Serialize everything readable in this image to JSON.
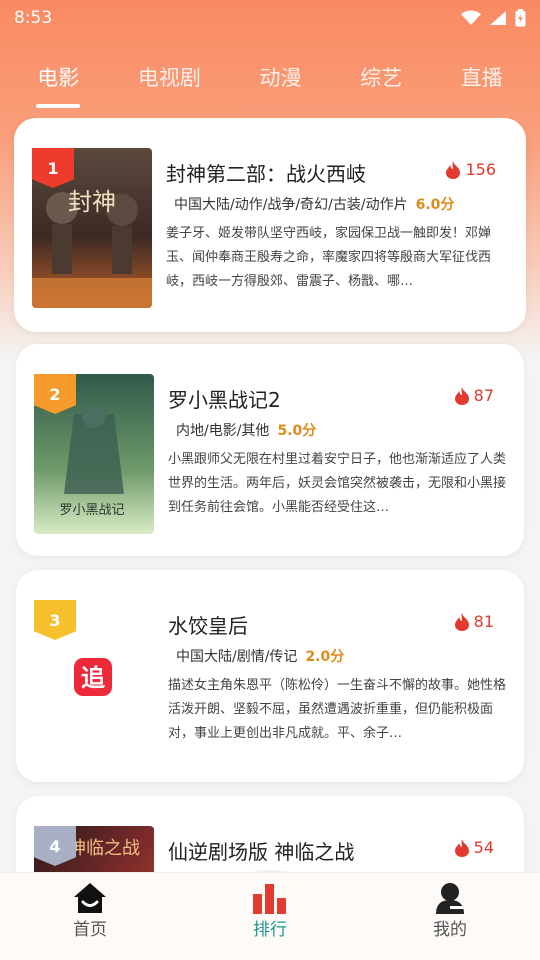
{
  "status_bar": {
    "time": "8:53"
  },
  "tabs": [
    {
      "label": "电影",
      "active": true
    },
    {
      "label": "电视剧",
      "active": false
    },
    {
      "label": "动漫",
      "active": false
    },
    {
      "label": "综艺",
      "active": false
    },
    {
      "label": "直播",
      "active": false
    }
  ],
  "items": [
    {
      "rank": "1",
      "title": "封神第二部：战火西岐",
      "hot": "156",
      "meta": "中国大陆/动作/战争/奇幻/古装/动作片",
      "score": "6.0分",
      "desc": "姜子牙、姬发带队坚守西岐，家园保卫战一触即发！邓婵玉、闻仲奉商王殷寿之命，率魔家四将等殷商大军征伐西岐，西岐一方得殷郊、雷震子、杨戬、哪…",
      "poster_text": "封神",
      "poster_colors": [
        "#3a2a24",
        "#9a4a2a",
        "#e0863a"
      ]
    },
    {
      "rank": "2",
      "title": "罗小黑战记2",
      "hot": "87",
      "meta": "内地/电影/其他",
      "score": "5.0分",
      "desc": "小黑跟师父无限在村里过着安宁日子，他也渐渐适应了人类世界的生活。两年后，妖灵会馆突然被袭击，无限和小黑接到任务前往会馆。小黑能否经受住这…",
      "poster_text": "罗小黑战记",
      "poster_colors": [
        "#2f5a4a",
        "#6f9a6a",
        "#c9e0b5"
      ]
    },
    {
      "rank": "3",
      "title": "水饺皇后",
      "hot": "81",
      "meta": "中国大陆/剧情/传记",
      "score": "2.0分",
      "desc": "描述女主角朱恩平（陈松伶）一生奋斗不懈的故事。她性格活泼开朗、坚毅不屈，虽然遭遇波折重重，但仍能积极面对，事业上更创出非凡成就。平、余子…",
      "poster_text": "追",
      "poster_colors": [
        "#ffffff",
        "#ffffff",
        "#ffffff"
      ]
    },
    {
      "rank": "4",
      "title": "仙逆剧场版 神临之战",
      "hot": "54",
      "meta": "",
      "score": "",
      "desc": "",
      "poster_text": "神临之战",
      "poster_colors": [
        "#2a1a1a",
        "#7a2a2a",
        "#c0502a"
      ]
    }
  ],
  "bottom_nav": [
    {
      "label": "首页",
      "icon": "home-icon",
      "active": false
    },
    {
      "label": "排行",
      "icon": "bar-chart-icon",
      "active": true
    },
    {
      "label": "我的",
      "icon": "user-icon",
      "active": false
    }
  ],
  "colors": {
    "accent": "#1a9b8e",
    "hot": "#e23a2e",
    "score": "#e08a1a",
    "header_gradient_start": "#f98a62"
  }
}
